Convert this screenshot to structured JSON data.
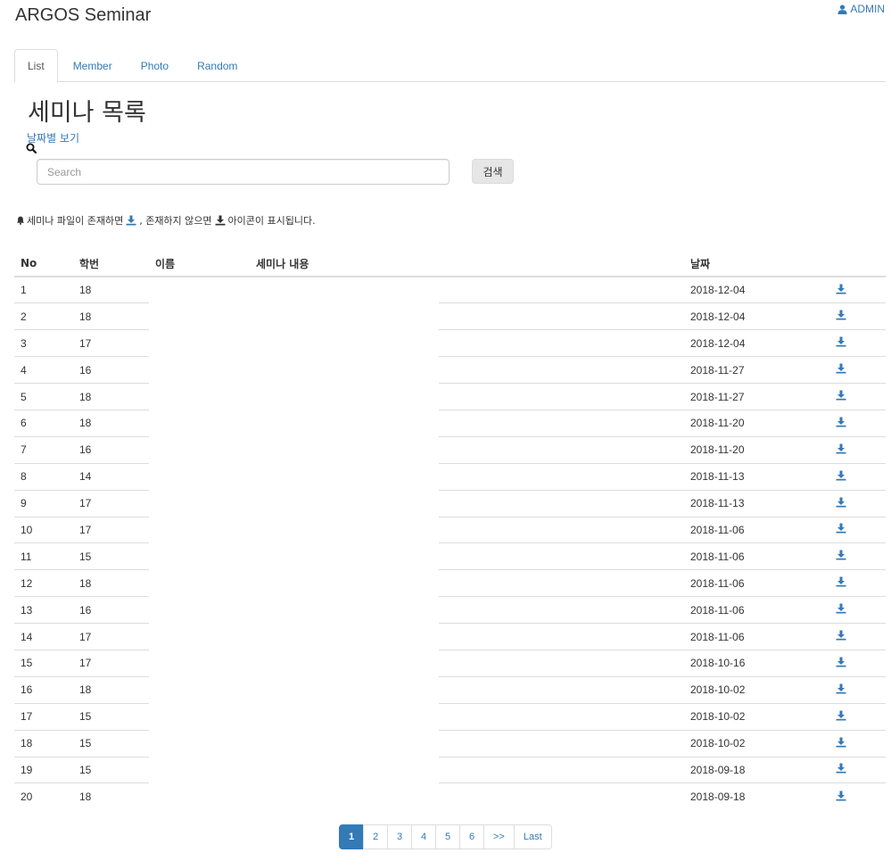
{
  "app": {
    "title": "ARGOS Seminar",
    "user_label": "ADMIN"
  },
  "tabs": [
    {
      "label": "List",
      "active": true
    },
    {
      "label": "Member"
    },
    {
      "label": "Photo"
    },
    {
      "label": "Random"
    }
  ],
  "page": {
    "heading": "세미나 목록",
    "date_view_link": "날짜별 보기"
  },
  "search": {
    "placeholder": "Search",
    "value": "",
    "button_label": "검색"
  },
  "notice": {
    "part1": "세미나 파일이 존재하면",
    "part2": ", 존재하지 않으면",
    "part3": "아이콘이 표시됩니다.",
    "icon_exists_color": "#337ab7",
    "icon_missing_color": "#333333"
  },
  "table": {
    "headers": {
      "no": "No",
      "student_id": "학번",
      "name": "이름",
      "content": "세미나 내용",
      "date": "날짜"
    },
    "rows": [
      {
        "no": "1",
        "student_id": "18",
        "date": "2018-12-04"
      },
      {
        "no": "2",
        "student_id": "18",
        "date": "2018-12-04"
      },
      {
        "no": "3",
        "student_id": "17",
        "date": "2018-12-04"
      },
      {
        "no": "4",
        "student_id": "16",
        "date": "2018-11-27"
      },
      {
        "no": "5",
        "student_id": "18",
        "date": "2018-11-27"
      },
      {
        "no": "6",
        "student_id": "18",
        "date": "2018-11-20"
      },
      {
        "no": "7",
        "student_id": "16",
        "date": "2018-11-20"
      },
      {
        "no": "8",
        "student_id": "14",
        "date": "2018-11-13"
      },
      {
        "no": "9",
        "student_id": "17",
        "date": "2018-11-13"
      },
      {
        "no": "10",
        "student_id": "17",
        "date": "2018-11-06"
      },
      {
        "no": "11",
        "student_id": "15",
        "date": "2018-11-06"
      },
      {
        "no": "12",
        "student_id": "18",
        "date": "2018-11-06"
      },
      {
        "no": "13",
        "student_id": "16",
        "date": "2018-11-06"
      },
      {
        "no": "14",
        "student_id": "17",
        "date": "2018-11-06"
      },
      {
        "no": "15",
        "student_id": "17",
        "date": "2018-10-16"
      },
      {
        "no": "16",
        "student_id": "18",
        "date": "2018-10-02"
      },
      {
        "no": "17",
        "student_id": "15",
        "date": "2018-10-02"
      },
      {
        "no": "18",
        "student_id": "15",
        "date": "2018-10-02"
      },
      {
        "no": "19",
        "student_id": "15",
        "date": "2018-09-18"
      },
      {
        "no": "20",
        "student_id": "18",
        "date": "2018-09-18"
      }
    ]
  },
  "pagination": {
    "pages": [
      "1",
      "2",
      "3",
      "4",
      "5",
      "6"
    ],
    "current": "1",
    "next_label": ">>",
    "last_label": "Last"
  },
  "colors": {
    "link": "#337ab7",
    "border": "#dddddd",
    "button_bg": "#e6e6e6"
  }
}
